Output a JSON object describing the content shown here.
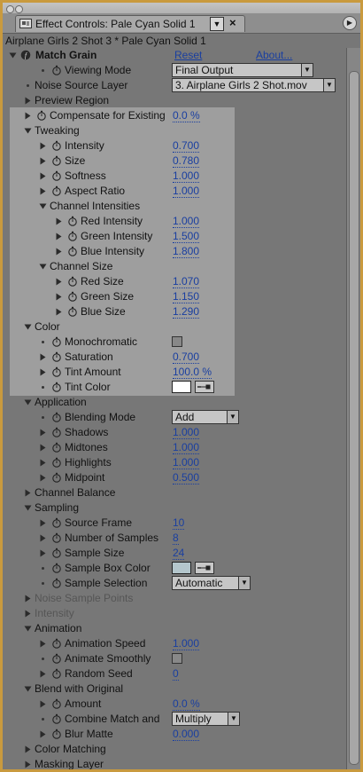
{
  "tab": {
    "title": "Effect Controls: Pale Cyan Solid 1"
  },
  "header": "Airplane Girls 2 Shot 3 * Pale Cyan Solid 1",
  "effect": {
    "name": "Match Grain",
    "reset": "Reset",
    "about": "About..."
  },
  "colors": {
    "value_text": "#1a3fa0",
    "panel_bg": "#777777",
    "highlight_bg": "#9e9e9e",
    "border": "#c99a3e",
    "tint_color": "#ffffff",
    "sample_box_color": "#b4c6cc"
  },
  "rows": [
    {
      "label": "Viewing Mode",
      "level": 2,
      "arrow": "none",
      "sw": true,
      "control": "dropdown",
      "value": "Final Output"
    },
    {
      "label": "Noise Source Layer",
      "level": 1,
      "arrow": "none",
      "sw": false,
      "control": "dropdown",
      "value": "3. Airplane Girls 2 Shot.mov"
    },
    {
      "label": "Preview Region",
      "level": 1,
      "arrow": "right",
      "sw": false,
      "control": "none"
    },
    {
      "label": "Compensate for Existing",
      "level": 1,
      "arrow": "right",
      "sw": true,
      "control": "value",
      "value": "0.0 %"
    },
    {
      "label": "Tweaking",
      "level": 1,
      "arrow": "down",
      "sw": false,
      "control": "none"
    },
    {
      "label": "Intensity",
      "level": 2,
      "arrow": "right",
      "sw": true,
      "control": "value",
      "value": "0.700"
    },
    {
      "label": "Size",
      "level": 2,
      "arrow": "right",
      "sw": true,
      "control": "value",
      "value": "0.780"
    },
    {
      "label": "Softness",
      "level": 2,
      "arrow": "right",
      "sw": true,
      "control": "value",
      "value": "1.000"
    },
    {
      "label": "Aspect Ratio",
      "level": 2,
      "arrow": "right",
      "sw": true,
      "control": "value",
      "value": "1.000"
    },
    {
      "label": "Channel Intensities",
      "level": 2,
      "arrow": "down",
      "sw": false,
      "control": "none"
    },
    {
      "label": "Red Intensity",
      "level": 3,
      "arrow": "right",
      "sw": true,
      "control": "value",
      "value": "1.000"
    },
    {
      "label": "Green Intensity",
      "level": 3,
      "arrow": "right",
      "sw": true,
      "control": "value",
      "value": "1.500"
    },
    {
      "label": "Blue Intensity",
      "level": 3,
      "arrow": "right",
      "sw": true,
      "control": "value",
      "value": "1.800"
    },
    {
      "label": "Channel Size",
      "level": 2,
      "arrow": "down",
      "sw": false,
      "control": "none"
    },
    {
      "label": "Red Size",
      "level": 3,
      "arrow": "right",
      "sw": true,
      "control": "value",
      "value": "1.070"
    },
    {
      "label": "Green Size",
      "level": 3,
      "arrow": "right",
      "sw": true,
      "control": "value",
      "value": "1.150"
    },
    {
      "label": "Blue Size",
      "level": 3,
      "arrow": "right",
      "sw": true,
      "control": "value",
      "value": "1.290"
    },
    {
      "label": "Color",
      "level": 1,
      "arrow": "down",
      "sw": false,
      "control": "none"
    },
    {
      "label": "Monochromatic",
      "level": 2,
      "arrow": "none",
      "sw": true,
      "control": "checkbox",
      "checked": false
    },
    {
      "label": "Saturation",
      "level": 2,
      "arrow": "right",
      "sw": true,
      "control": "value",
      "value": "0.700"
    },
    {
      "label": "Tint Amount",
      "level": 2,
      "arrow": "right",
      "sw": true,
      "control": "value",
      "value": "100.0 %"
    },
    {
      "label": "Tint Color",
      "level": 2,
      "arrow": "none",
      "sw": true,
      "control": "color",
      "color_key": "tint_color"
    },
    {
      "label": "Application",
      "level": 1,
      "arrow": "down",
      "sw": false,
      "control": "none"
    },
    {
      "label": "Blending Mode",
      "level": 2,
      "arrow": "none",
      "sw": true,
      "control": "dropdown",
      "value": "Add"
    },
    {
      "label": "Shadows",
      "level": 2,
      "arrow": "right",
      "sw": true,
      "control": "value",
      "value": "1.000"
    },
    {
      "label": "Midtones",
      "level": 2,
      "arrow": "right",
      "sw": true,
      "control": "value",
      "value": "1.000"
    },
    {
      "label": "Highlights",
      "level": 2,
      "arrow": "right",
      "sw": true,
      "control": "value",
      "value": "1.000"
    },
    {
      "label": "Midpoint",
      "level": 2,
      "arrow": "right",
      "sw": true,
      "control": "value",
      "value": "0.500"
    },
    {
      "label": "Channel Balance",
      "level": 1,
      "arrow": "right",
      "sw": false,
      "control": "none"
    },
    {
      "label": "Sampling",
      "level": 1,
      "arrow": "down",
      "sw": false,
      "control": "none"
    },
    {
      "label": "Source Frame",
      "level": 2,
      "arrow": "right",
      "sw": true,
      "control": "value",
      "value": "10"
    },
    {
      "label": "Number of Samples",
      "level": 2,
      "arrow": "right",
      "sw": true,
      "control": "value",
      "value": "8"
    },
    {
      "label": "Sample Size",
      "level": 2,
      "arrow": "right",
      "sw": true,
      "control": "value",
      "value": "24"
    },
    {
      "label": "Sample Box Color",
      "level": 2,
      "arrow": "none",
      "sw": true,
      "control": "color",
      "color_key": "sample_box_color"
    },
    {
      "label": "Sample Selection",
      "level": 2,
      "arrow": "none",
      "sw": true,
      "control": "dropdown",
      "value": "Automatic"
    },
    {
      "label": "Noise Sample Points",
      "level": 1,
      "arrow": "right",
      "sw": false,
      "control": "none",
      "dim": true
    },
    {
      "label": "Intensity",
      "level": 1,
      "arrow": "right",
      "sw": false,
      "control": "none",
      "dim": true
    },
    {
      "label": "Animation",
      "level": 1,
      "arrow": "down",
      "sw": false,
      "control": "none"
    },
    {
      "label": "Animation Speed",
      "level": 2,
      "arrow": "right",
      "sw": true,
      "control": "value",
      "value": "1.000"
    },
    {
      "label": "Animate Smoothly",
      "level": 2,
      "arrow": "none",
      "sw": true,
      "control": "checkbox",
      "checked": false
    },
    {
      "label": "Random Seed",
      "level": 2,
      "arrow": "right",
      "sw": true,
      "control": "value",
      "value": "0"
    },
    {
      "label": "Blend with Original",
      "level": 1,
      "arrow": "down",
      "sw": false,
      "control": "none"
    },
    {
      "label": "Amount",
      "level": 2,
      "arrow": "right",
      "sw": true,
      "control": "value",
      "value": "0.0 %"
    },
    {
      "label": "Combine Match and",
      "level": 2,
      "arrow": "none",
      "sw": true,
      "control": "dropdown",
      "value": "Multiply"
    },
    {
      "label": "Blur Matte",
      "level": 2,
      "arrow": "right",
      "sw": true,
      "control": "value",
      "value": "0.000"
    },
    {
      "label": "Color Matching",
      "level": 1,
      "arrow": "right",
      "sw": false,
      "control": "none"
    },
    {
      "label": "Masking Layer",
      "level": 1,
      "arrow": "right",
      "sw": false,
      "control": "none"
    }
  ]
}
